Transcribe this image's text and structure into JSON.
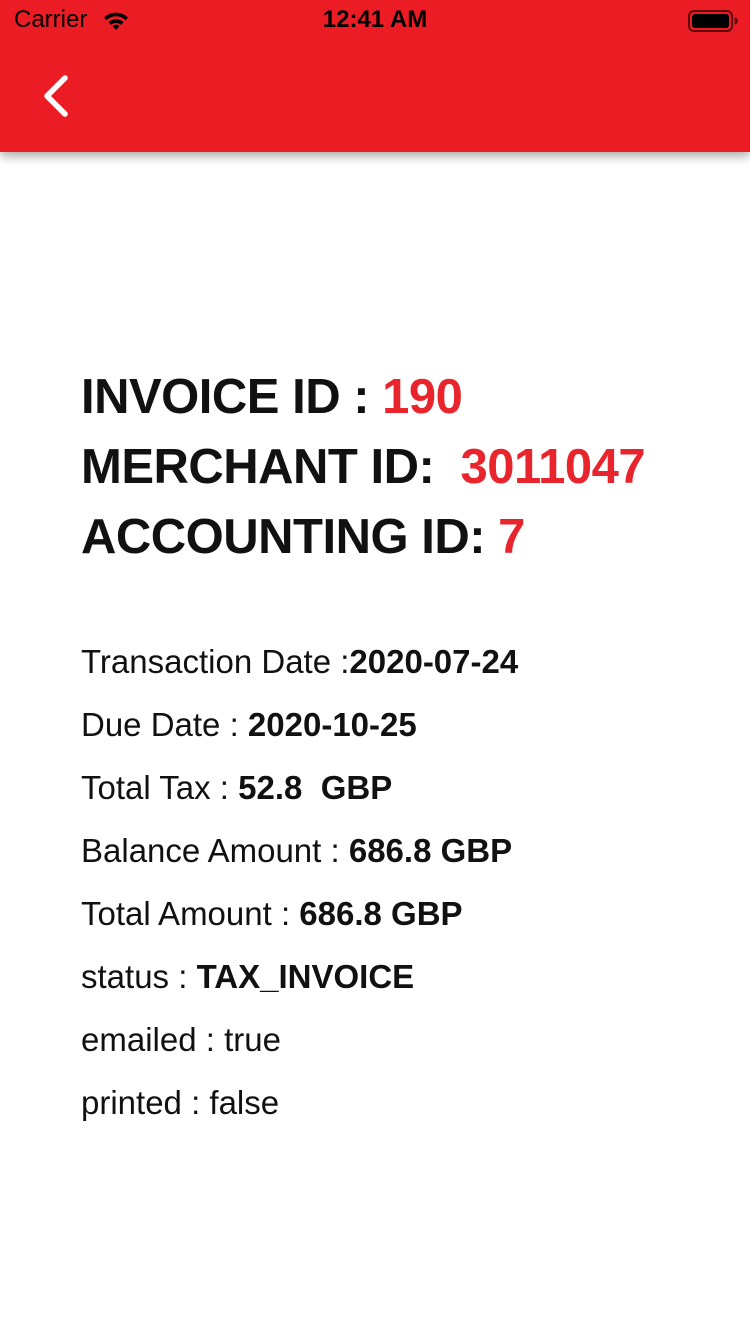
{
  "status_bar": {
    "carrier": "Carrier",
    "time": "12:41 AM",
    "icons": [
      "wifi-icon",
      "battery-icon"
    ]
  },
  "header": {
    "back_icon": "chevron-left-icon",
    "background_color": "#ec1c24"
  },
  "invoice": {
    "invoice_id_label": "INVOICE ID : ",
    "invoice_id_value": "190",
    "merchant_id_label": "MERCHANT ID:  ",
    "merchant_id_value": "3011047",
    "accounting_id_label": "ACCOUNTING ID: ",
    "accounting_id_value": "7",
    "accent_color": "#e8242c"
  },
  "details": {
    "transaction_date_label": "Transaction Date :",
    "transaction_date_value": "2020-07-24",
    "due_date_label": "Due Date : ",
    "due_date_value": "2020-10-25",
    "total_tax_label": "Total Tax : ",
    "total_tax_value": "52.8  GBP",
    "balance_amount_label": "Balance Amount : ",
    "balance_amount_value": "686.8 GBP",
    "total_amount_label": "Total Amount : ",
    "total_amount_value": "686.8 GBP",
    "status_label": "status : ",
    "status_value": "TAX_INVOICE",
    "emailed_text": "emailed : true",
    "printed_text": "printed : false"
  }
}
